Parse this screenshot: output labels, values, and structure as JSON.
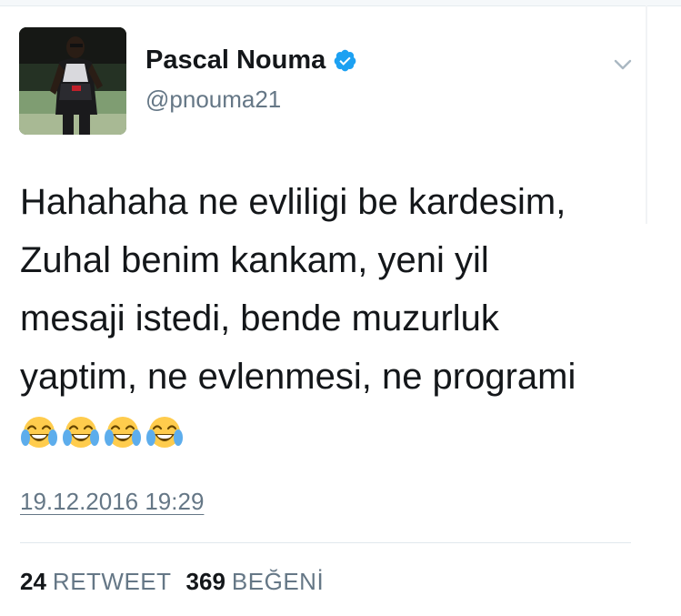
{
  "tweet": {
    "author": {
      "display_name": "Pascal Nouma",
      "handle": "@pnouma21",
      "verified": true,
      "avatar_icon": "profile-photo"
    },
    "text": "Hahahaha ne evliligi be kardesim,\nZuhal benim kankam, yeni yil\nmesaji istedi, bende muzurluk\nyaptim, ne evlenmesi, ne programi",
    "emojis": [
      "face-with-tears-of-joy",
      "face-with-tears-of-joy",
      "face-with-tears-of-joy",
      "face-with-tears-of-joy"
    ],
    "timestamp": "19.12.2016 19:29",
    "stats": {
      "retweet_count": "24",
      "retweet_label": "RETWEET",
      "like_count": "369",
      "like_label": "BEĞENİ"
    }
  },
  "colors": {
    "text_primary": "#14171a",
    "text_secondary": "#657786",
    "verified_blue": "#1da1f2",
    "divider": "#e1e8ed"
  }
}
